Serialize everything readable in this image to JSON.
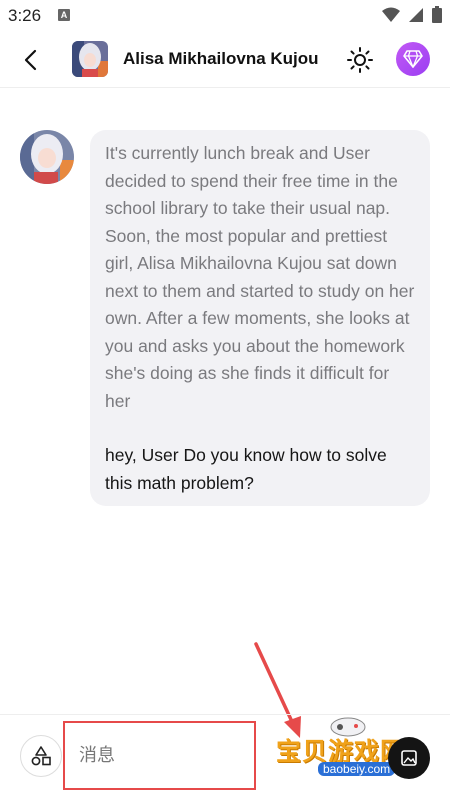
{
  "status_bar": {
    "time": "3:26",
    "notification_letter": "A"
  },
  "header": {
    "title": "Alisa Mikhailovna Kujou"
  },
  "chat": {
    "narration": "It's currently lunch break and User decided to spend their free time in the school library to take their usual nap. Soon, the most popular and prettiest girl, Alisa Mikhailovna Kujou sat down next to them and started to study on her own. After a few moments, she looks at you and asks you about the homework she's doing as she finds it difficult for her",
    "dialogue": "hey, User Do you know how to solve this math problem?"
  },
  "composer": {
    "placeholder": "消息"
  },
  "watermark": {
    "text": "宝贝游戏网",
    "url": "baobeiy.com"
  },
  "colors": {
    "bubble_bg": "#f2f2f5",
    "narration_text": "#7a7a7e",
    "accent_purple": "#b44cf4",
    "highlight_red": "#e64a4a"
  }
}
